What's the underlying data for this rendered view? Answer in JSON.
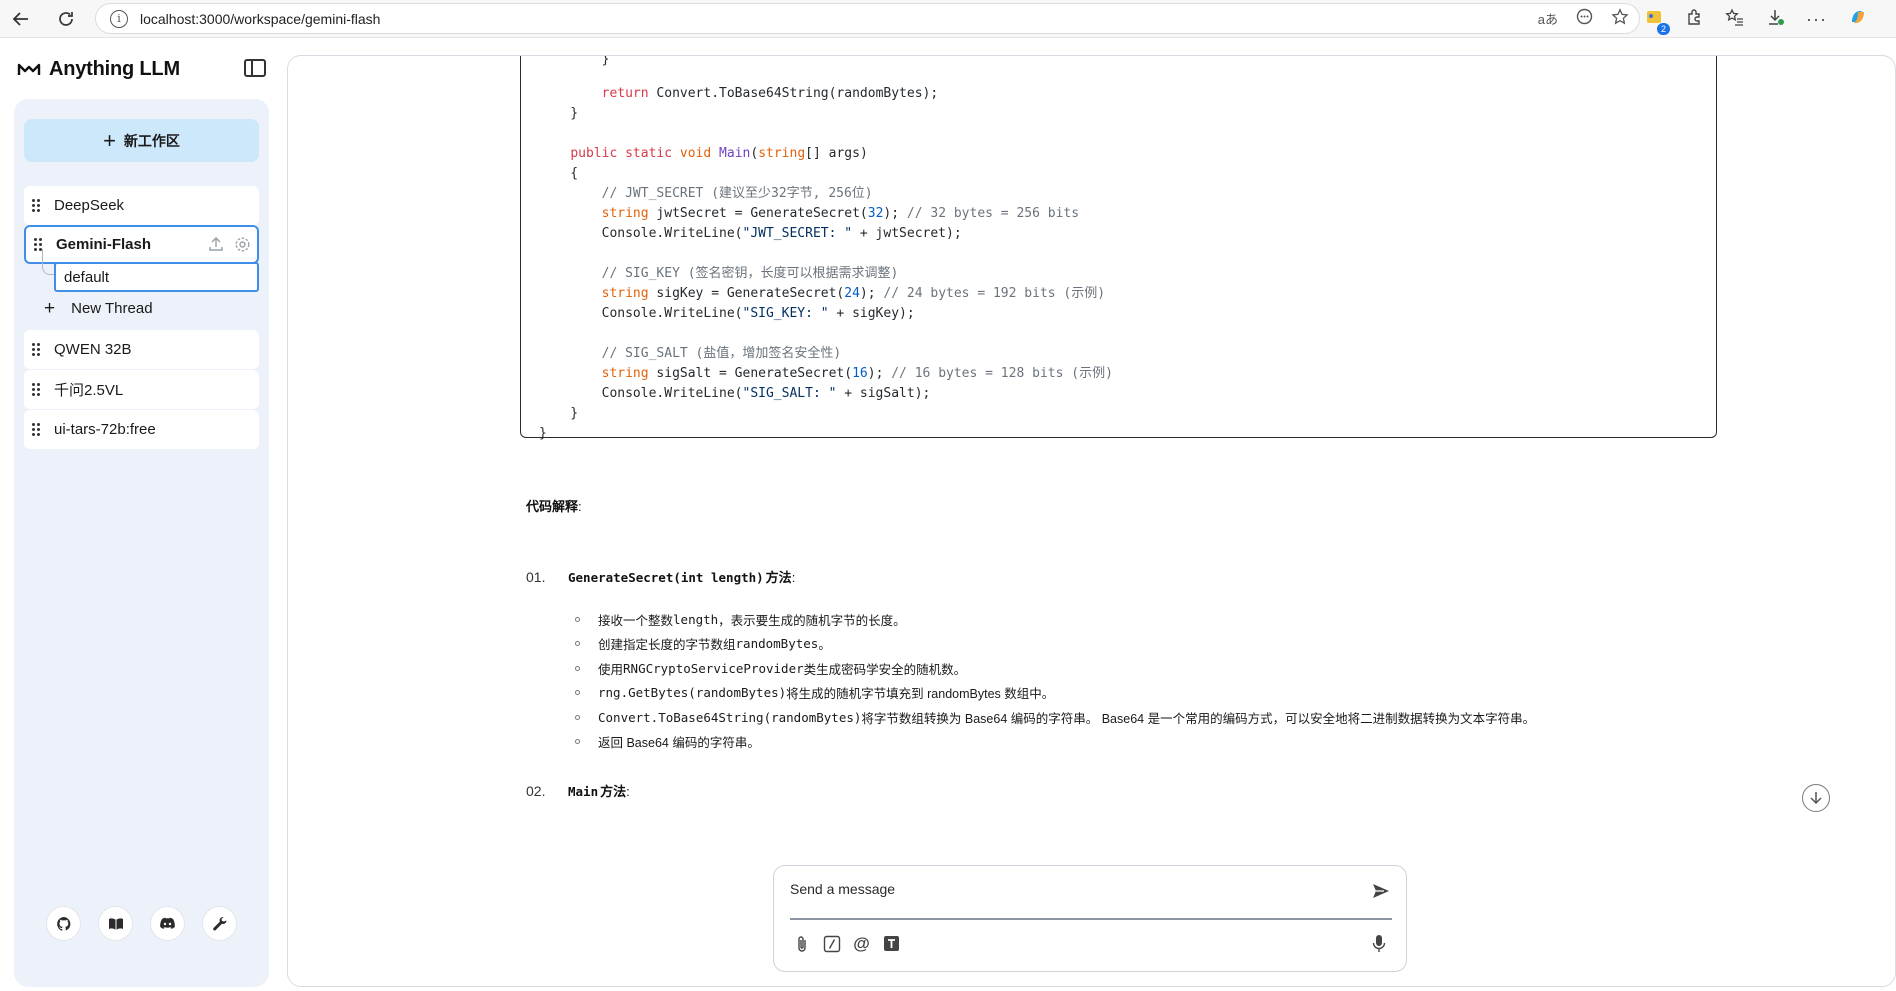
{
  "browser": {
    "url": "localhost:3000/workspace/gemini-flash",
    "extension_badge": "2",
    "read_aloud_icon": "aあ"
  },
  "app": {
    "brand_name": "Anything LLM",
    "new_workspace_label": "新工作区",
    "workspaces": [
      {
        "name": "DeepSeek"
      },
      {
        "name": "Gemini-Flash"
      },
      {
        "name": "QWEN 32B"
      },
      {
        "name": "千问2.5VL"
      },
      {
        "name": "ui-tars-72b:free"
      }
    ],
    "active_workspace": "Gemini-Flash",
    "thread_default": "default",
    "new_thread_label": "New Thread",
    "footer_icons": [
      "github-icon",
      "book-icon",
      "discord-icon",
      "wrench-icon"
    ]
  },
  "chat": {
    "section_title": "代码解释",
    "section_colon": ":",
    "item1": {
      "num": "01.",
      "code": "GenerateSecret(int length)",
      "label": "方法",
      "colon": ":"
    },
    "item1_bullets": [
      {
        "a": "接收一个整数 ",
        "c": "length",
        "b": "，表示要生成的随机字节的长度。"
      },
      {
        "a": "创建指定长度的字节数组 ",
        "c": "randomBytes",
        "b": "。"
      },
      {
        "a": "使用 ",
        "c": "RNGCryptoServiceProvider",
        "b": " 类生成密码学安全的随机数。"
      },
      {
        "a": "",
        "c": "rng.GetBytes(randomBytes)",
        "b": " 将生成的随机字节填充到 randomBytes 数组中。"
      },
      {
        "a": "",
        "c": "Convert.ToBase64String(randomBytes)",
        "b": " 将字节数组转换为 Base64 编码的字符串。 Base64 是一个常用的编码方式，可以安全地将二进制数据转换为文本字符串。"
      },
      {
        "a": "返回 Base64 编码的字符串。",
        "c": "",
        "b": ""
      }
    ],
    "item2": {
      "num": "02.",
      "code": "Main",
      "label": "方法",
      "colon": ":"
    },
    "composer_placeholder": "Send a message"
  }
}
